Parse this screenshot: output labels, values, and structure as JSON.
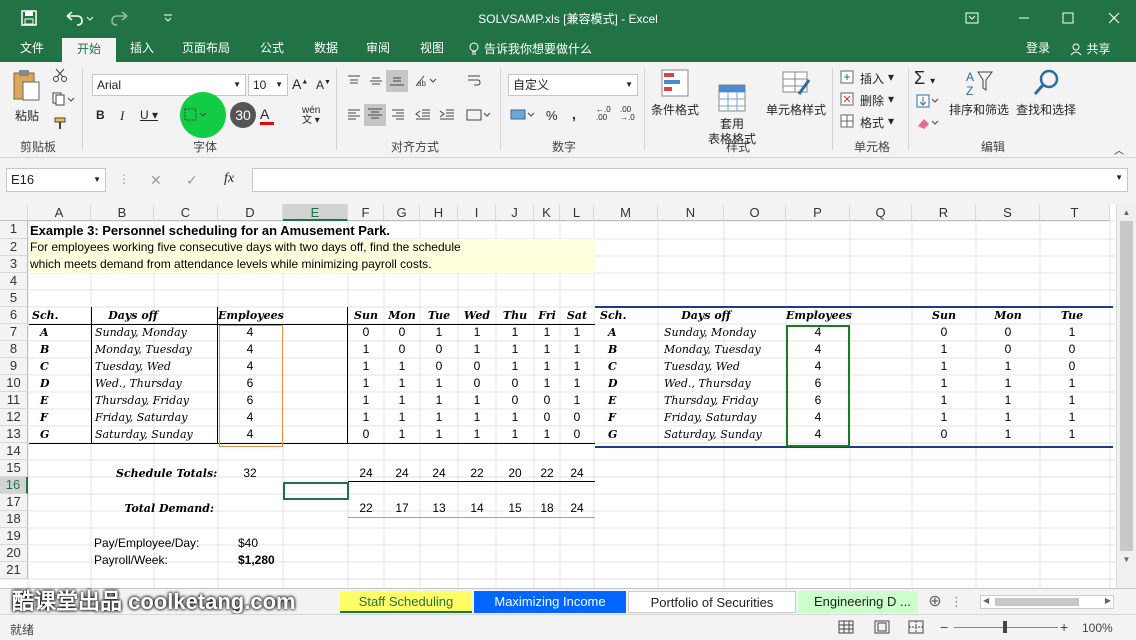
{
  "titlebar": {
    "title": "SOLVSAMP.xls  [兼容模式] - Excel"
  },
  "tabs": [
    "文件",
    "开始",
    "插入",
    "页面布局",
    "公式",
    "数据",
    "审阅",
    "视图"
  ],
  "tell_me": "告诉我你想要做什么",
  "login": "登录",
  "share": "共享",
  "ribbon": {
    "paste": "粘贴",
    "clipboard": "剪贴板",
    "font_name": "Arial",
    "font_size": "10",
    "font_group": "字体",
    "align_group": "对齐方式",
    "number_format": "自定义",
    "number_group": "数字",
    "cond_format": "条件格式",
    "table_format": "套用\n表格格式",
    "cell_style": "单元格样式",
    "style_group": "样式",
    "insert": "插入",
    "delete": "删除",
    "format": "格式",
    "cells_group": "单元格",
    "sort_filter": "排序和筛选",
    "find_select": "查找和选择",
    "edit_group": "编辑",
    "badge": "30",
    "fx": "fx",
    "percent": "%",
    "comma": ","
  },
  "namebox": "E16",
  "columns": [
    "A",
    "B",
    "C",
    "D",
    "E",
    "F",
    "G",
    "H",
    "I",
    "J",
    "K",
    "L",
    "M",
    "N",
    "O",
    "P",
    "Q",
    "R",
    "S",
    "T"
  ],
  "rows": [
    "1",
    "2",
    "3",
    "4",
    "5",
    "6",
    "7",
    "8",
    "9",
    "10",
    "11",
    "12",
    "13",
    "14",
    "15",
    "16",
    "17",
    "18",
    "19",
    "20",
    "21"
  ],
  "sheet": {
    "title": "Example 3:  Personnel scheduling for an Amusement Park.",
    "desc1": "For employees working five consecutive days with two days off, find the schedule",
    "desc2": "which meets demand from attendance levels while minimizing payroll costs.",
    "hdr_sch": "Sch.",
    "hdr_days": "Days off",
    "hdr_emp": "Employees",
    "days": [
      "Sun",
      "Mon",
      "Tue",
      "Wed",
      "Thu",
      "Fri",
      "Sat"
    ],
    "schedule": [
      {
        "sch": "A",
        "off": "Sunday, Monday",
        "emp": "4",
        "d": [
          "0",
          "0",
          "1",
          "1",
          "1",
          "1",
          "1"
        ]
      },
      {
        "sch": "B",
        "off": "Monday, Tuesday",
        "emp": "4",
        "d": [
          "1",
          "0",
          "0",
          "1",
          "1",
          "1",
          "1"
        ]
      },
      {
        "sch": "C",
        "off": "Tuesday, Wed",
        "emp": "4",
        "d": [
          "1",
          "1",
          "0",
          "0",
          "1",
          "1",
          "1"
        ]
      },
      {
        "sch": "D",
        "off": "Wed., Thursday",
        "emp": "6",
        "d": [
          "1",
          "1",
          "1",
          "0",
          "0",
          "1",
          "1"
        ]
      },
      {
        "sch": "E",
        "off": "Thursday, Friday",
        "emp": "6",
        "d": [
          "1",
          "1",
          "1",
          "1",
          "0",
          "0",
          "1"
        ]
      },
      {
        "sch": "F",
        "off": "Friday, Saturday",
        "emp": "4",
        "d": [
          "1",
          "1",
          "1",
          "1",
          "1",
          "0",
          "0"
        ]
      },
      {
        "sch": "G",
        "off": "Saturday, Sunday",
        "emp": "4",
        "d": [
          "0",
          "1",
          "1",
          "1",
          "1",
          "1",
          "0"
        ]
      }
    ],
    "sched_totals_label": "Schedule Totals:",
    "sched_totals_emp": "32",
    "sched_totals": [
      "24",
      "24",
      "24",
      "22",
      "20",
      "22",
      "24"
    ],
    "total_demand_label": "Total Demand:",
    "total_demand": [
      "22",
      "17",
      "13",
      "14",
      "15",
      "18",
      "24"
    ],
    "pay_label": "Pay/Employee/Day:",
    "pay_value": "$40",
    "payroll_label": "Payroll/Week:",
    "payroll_value": "$1,280",
    "right_days": [
      "Sun",
      "Mon",
      "Tue"
    ],
    "right_vals": [
      [
        "0",
        "0",
        "1"
      ],
      [
        "1",
        "0",
        "0"
      ],
      [
        "1",
        "1",
        "0"
      ],
      [
        "1",
        "1",
        "1"
      ],
      [
        "1",
        "1",
        "1"
      ],
      [
        "1",
        "1",
        "1"
      ],
      [
        "0",
        "1",
        "1"
      ]
    ]
  },
  "sheet_tabs": [
    "Staff Scheduling",
    "Maximizing Income",
    "Portfolio of Securities",
    "Engineering D ..."
  ],
  "status": {
    "ready": "就绪",
    "zoom": "100%"
  },
  "watermark": "酷课堂出品 coolketang.com",
  "colors": {
    "excel_green": "#217346",
    "tab_yellow": "#ffff66",
    "tab_blue": "#0066ff",
    "tab_green": "#ccffcc"
  }
}
